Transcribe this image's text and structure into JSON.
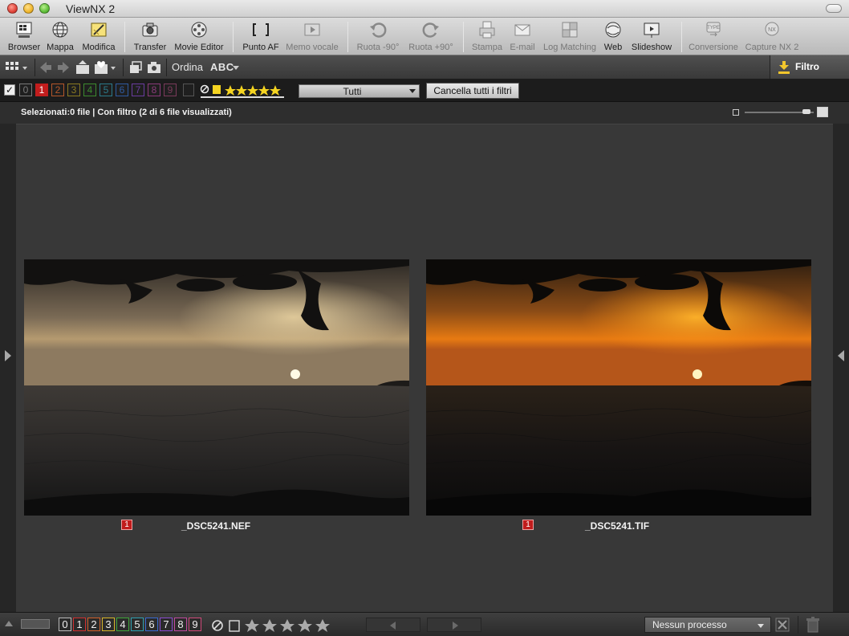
{
  "app": {
    "title": "ViewNX 2"
  },
  "toolbar": {
    "buttons": [
      {
        "label": "Browser",
        "icon": "browser-grid-icon"
      },
      {
        "label": "Mappa",
        "icon": "globe-icon"
      },
      {
        "label": "Modifica",
        "icon": "edit-pencil-icon"
      },
      {
        "label": "Transfer",
        "icon": "camera-transfer-icon"
      },
      {
        "label": "Movie Editor",
        "icon": "film-reel-icon"
      },
      {
        "label": "Punto AF",
        "icon": "af-point-icon"
      },
      {
        "label": "Memo vocale",
        "icon": "play-memo-icon"
      },
      {
        "label": "Ruota -90°",
        "icon": "rotate-left-icon"
      },
      {
        "label": "Ruota +90°",
        "icon": "rotate-right-icon"
      },
      {
        "label": "Stampa",
        "icon": "printer-icon"
      },
      {
        "label": "E-mail",
        "icon": "envelope-icon"
      },
      {
        "label": "Log Matching",
        "icon": "log-matching-icon"
      },
      {
        "label": "Web",
        "icon": "web-upload-icon"
      },
      {
        "label": "Slideshow",
        "icon": "slideshow-icon"
      },
      {
        "label": "Conversione",
        "icon": "convert-type-icon"
      },
      {
        "label": "Capture NX 2",
        "icon": "capture-nx-icon"
      }
    ]
  },
  "toolbar2": {
    "sort_label": "Ordina",
    "sort_value": "ABC",
    "filter_label": "Filtro"
  },
  "filterbar": {
    "labels": [
      "0",
      "1",
      "2",
      "3",
      "4",
      "5",
      "6",
      "7",
      "8",
      "9"
    ],
    "label_colors": [
      "#7a7a7a",
      "#c21d1d",
      "#b5572a",
      "#8a7a22",
      "#3c8a2e",
      "#2b7a8a",
      "#2f5aa0",
      "#6a3ca0",
      "#8a3a7a",
      "#7a3a5a"
    ],
    "dropdown_value": "Tutti",
    "clear_button": "Cancella tutti i filtri"
  },
  "status": {
    "text": "Selezionati:0 file | Con filtro (2 di 6 file visualizzati)"
  },
  "thumbnails": [
    {
      "name": "_DSC5241.NEF",
      "label": "1"
    },
    {
      "name": "_DSC5241.TIF",
      "label": "1"
    }
  ],
  "bottombar": {
    "labels": [
      "0",
      "1",
      "2",
      "3",
      "4",
      "5",
      "6",
      "7",
      "8",
      "9"
    ],
    "label_colors": [
      "#bbbbbb",
      "#d03030",
      "#d0602a",
      "#d6b52a",
      "#3fa53a",
      "#2fa0b0",
      "#3a6ad0",
      "#8a4ad0",
      "#c04aa0",
      "#d04a7a"
    ],
    "process_value": "Nessun processo"
  }
}
